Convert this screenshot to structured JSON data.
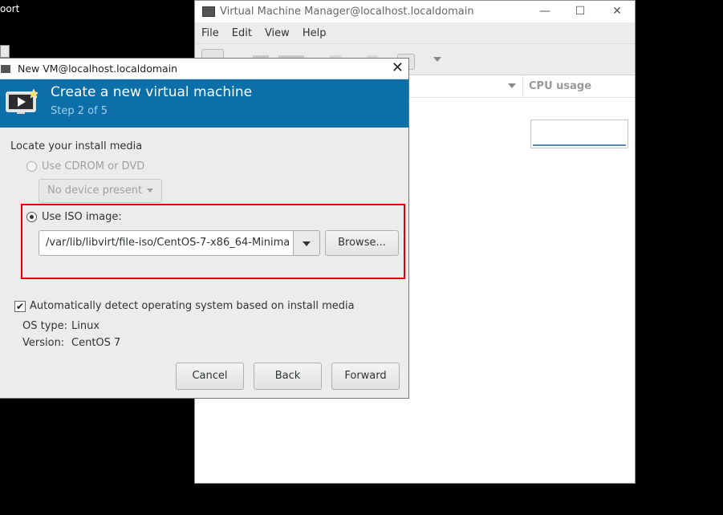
{
  "desktop": {
    "fragment_text": "oort"
  },
  "vmm": {
    "title": "Virtual Machine Manager@localhost.localdomain",
    "controls": {
      "minimize": "—",
      "maximize": "☐",
      "close": "✕"
    },
    "menu": [
      "File",
      "Edit",
      "View",
      "Help"
    ],
    "columns": {
      "cpu_usage": "CPU usage"
    }
  },
  "dialog": {
    "title": "New VM@localhost.localdomain",
    "close": "✕",
    "banner": {
      "title": "Create a new virtual machine",
      "step": "Step 2 of 5"
    },
    "section_label": "Locate your install media",
    "cdrom": {
      "label": "Use CDROM or DVD",
      "device": "No device present",
      "selected": false,
      "enabled": false
    },
    "iso": {
      "label": "Use ISO image:",
      "path": "/var/lib/libvirt/file-iso/CentOS-7-x86_64-Minima",
      "browse_label": "Browse...",
      "selected": true
    },
    "autodetect": {
      "label": "Automatically detect operating system based on install media",
      "checked": true
    },
    "os_type": {
      "label": "OS type:",
      "value": "Linux"
    },
    "version": {
      "label": "Version:",
      "value": "CentOS 7"
    },
    "buttons": {
      "cancel": "Cancel",
      "back": "Back",
      "forward": "Forward"
    }
  },
  "colors": {
    "banner": "#0d6fa8",
    "highlight": "#e00000",
    "step_text": "#9fd0ee"
  }
}
